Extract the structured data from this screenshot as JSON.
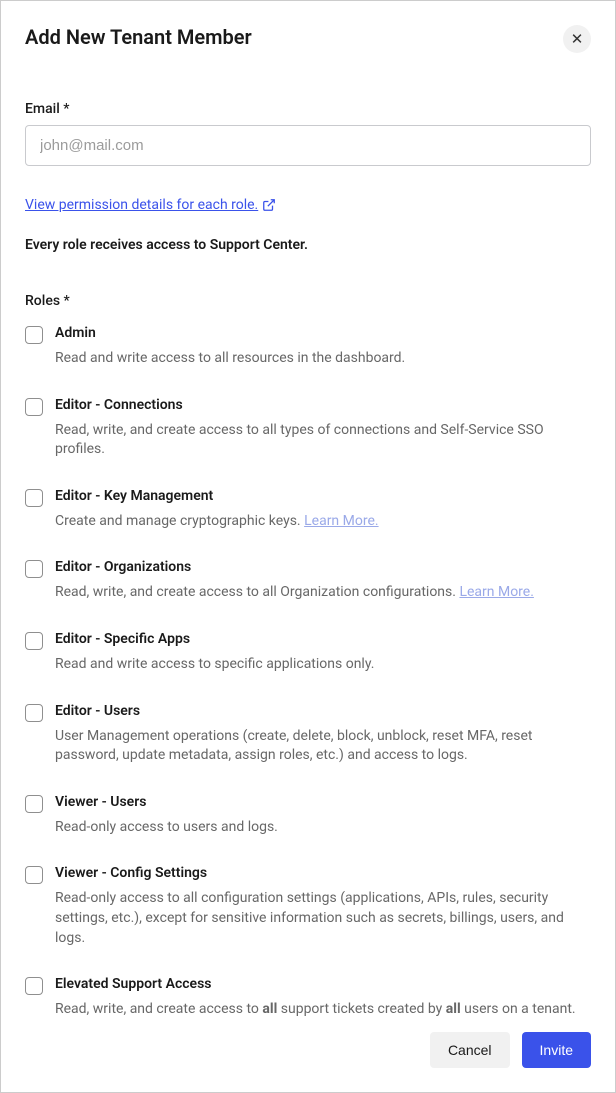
{
  "header": {
    "title": "Add New Tenant Member"
  },
  "email": {
    "label": "Email *",
    "placeholder": "john@mail.com"
  },
  "permissionLink": {
    "text": "View permission details for each role."
  },
  "supportNote": "Every role receives access to Support Center.",
  "rolesLabel": "Roles *",
  "roles": [
    {
      "title": "Admin",
      "desc": "Read and write access to all resources in the dashboard.",
      "learnMore": null
    },
    {
      "title": "Editor - Connections",
      "desc": "Read, write, and create access to all types of connections and Self-Service SSO profiles.",
      "learnMore": null
    },
    {
      "title": "Editor - Key Management",
      "desc": "Create and manage cryptographic keys. ",
      "learnMore": "Learn More."
    },
    {
      "title": "Editor - Organizations",
      "desc": "Read, write, and create access to all Organization configurations. ",
      "learnMore": "Learn More."
    },
    {
      "title": "Editor - Specific Apps",
      "desc": "Read and write access to specific applications only.",
      "learnMore": null
    },
    {
      "title": "Editor - Users",
      "desc": "User Management operations (create, delete, block, unblock, reset MFA, reset password, update metadata, assign roles, etc.) and access to logs.",
      "learnMore": null
    },
    {
      "title": "Viewer - Users",
      "desc": "Read-only access to users and logs.",
      "learnMore": null
    },
    {
      "title": "Viewer - Config Settings",
      "desc": "Read-only access to all configuration settings (applications, APIs, rules, security settings, etc.), except for sensitive information such as secrets, billings, users, and logs.",
      "learnMore": null
    }
  ],
  "elevated": {
    "title": "Elevated Support Access",
    "descPrefix": "Read, write, and create access to ",
    "all1": "all",
    "descMid": " support tickets created by ",
    "all2": "all",
    "descSuffix": " users on a tenant. Access to aggregated metrics."
  },
  "footer": {
    "cancel": "Cancel",
    "invite": "Invite"
  }
}
